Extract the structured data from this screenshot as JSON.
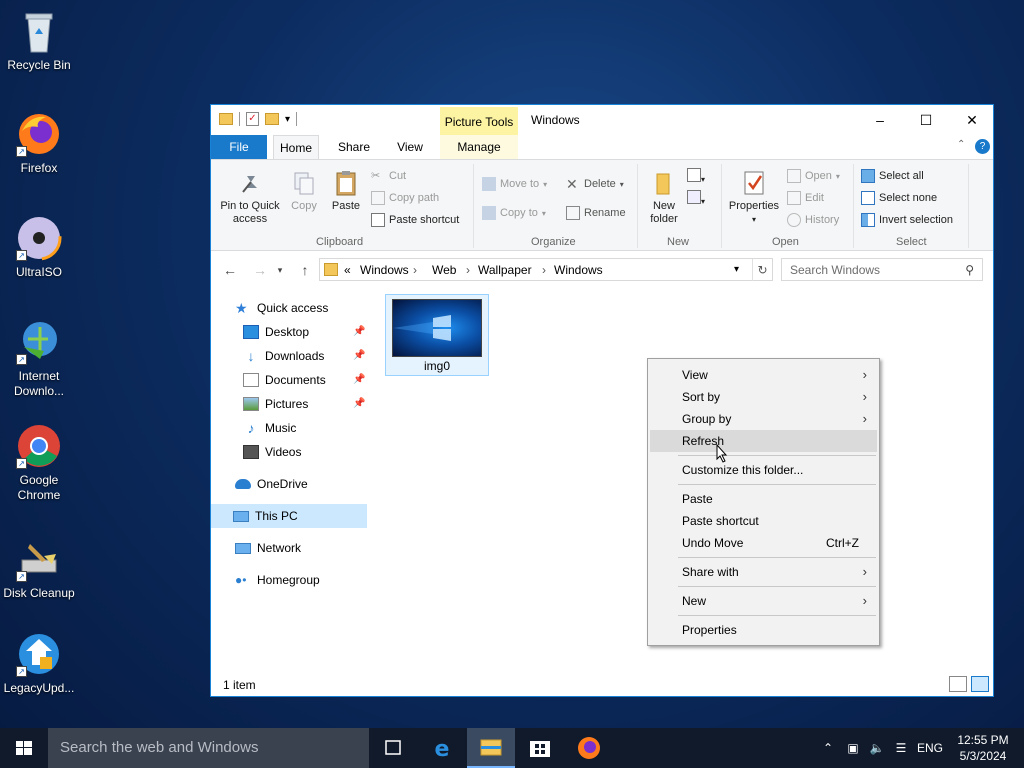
{
  "desktop": {
    "icons": [
      {
        "label": "Recycle Bin",
        "icon": "recycle-bin-icon"
      },
      {
        "label": "Firefox",
        "icon": "firefox-icon"
      },
      {
        "label": "UltraISO",
        "icon": "disc-icon"
      },
      {
        "label": "Internet Downlo...",
        "icon": "download-manager-icon"
      },
      {
        "label": "Google Chrome",
        "icon": "chrome-icon"
      },
      {
        "label": "Disk Cleanup",
        "icon": "disk-cleanup-icon"
      },
      {
        "label": "LegacyUpd...",
        "icon": "legacy-update-icon"
      }
    ]
  },
  "window": {
    "title": "Windows",
    "contextual_tab_group": "Picture Tools",
    "tabs": [
      "File",
      "Home",
      "Share",
      "View",
      "Manage"
    ],
    "active_tab": "Home",
    "ribbon": {
      "clipboard": {
        "label": "Clipboard",
        "pin": "Pin to Quick access",
        "copy": "Copy",
        "paste": "Paste",
        "cut": "Cut",
        "copy_path": "Copy path",
        "paste_shortcut": "Paste shortcut"
      },
      "organize": {
        "label": "Organize",
        "move_to": "Move to",
        "copy_to": "Copy to",
        "delete": "Delete",
        "rename": "Rename"
      },
      "new": {
        "label": "New",
        "new_folder": "New folder"
      },
      "open": {
        "label": "Open",
        "properties": "Properties",
        "open": "Open",
        "edit": "Edit",
        "history": "History"
      },
      "select": {
        "label": "Select",
        "select_all": "Select all",
        "select_none": "Select none",
        "invert": "Invert selection"
      }
    },
    "address": {
      "overflow": "«",
      "crumbs": [
        "Windows",
        "Web",
        "Wallpaper",
        "Windows"
      ],
      "search_placeholder": "Search Windows"
    },
    "nav_pane": {
      "quick_access": "Quick access",
      "pinned": [
        "Desktop",
        "Downloads",
        "Documents",
        "Pictures"
      ],
      "unpinned": [
        "Music",
        "Videos"
      ],
      "onedrive": "OneDrive",
      "this_pc": "This PC",
      "network": "Network",
      "homegroup": "Homegroup"
    },
    "files": [
      {
        "name": "img0"
      }
    ],
    "status": "1 item"
  },
  "context_menu": {
    "view": "View",
    "sort_by": "Sort by",
    "group_by": "Group by",
    "refresh": "Refresh",
    "customize": "Customize this folder...",
    "paste": "Paste",
    "paste_shortcut": "Paste shortcut",
    "undo_move": "Undo Move",
    "undo_shortcut": "Ctrl+Z",
    "share_with": "Share with",
    "new": "New",
    "properties": "Properties"
  },
  "taskbar": {
    "search_placeholder": "Search the web and Windows",
    "language": "ENG",
    "time": "12:55 PM",
    "date": "5/3/2024"
  },
  "colors": {
    "accent": "#1979ca",
    "selection": "#cce8ff",
    "picture_tools": "#fcf4a3"
  }
}
